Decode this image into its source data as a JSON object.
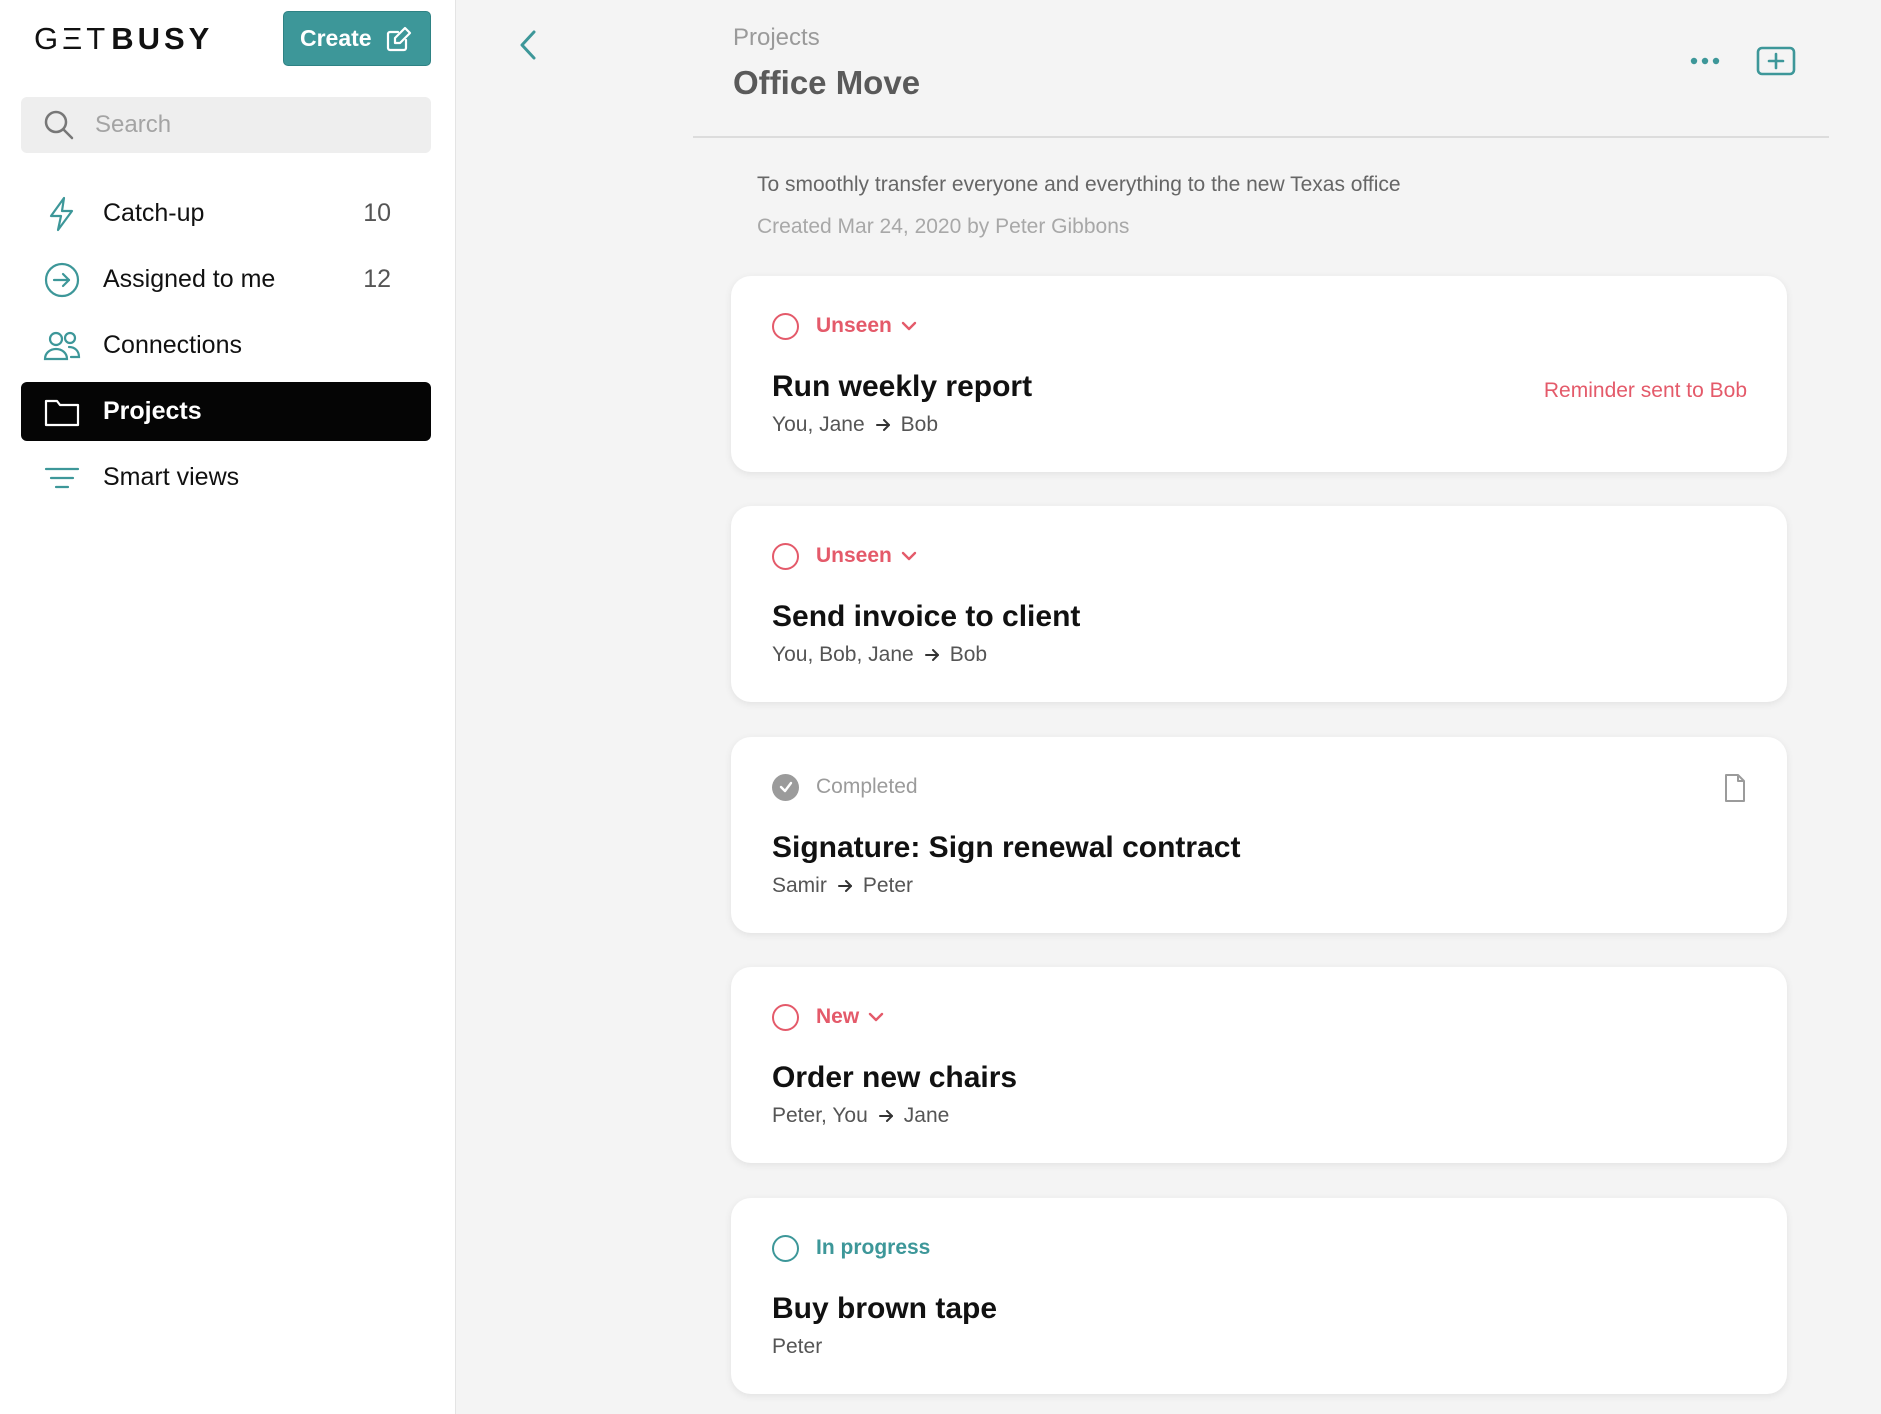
{
  "app": {
    "logo_light": "GΞT",
    "logo_bold": "BUSY",
    "create_label": "Create"
  },
  "search": {
    "placeholder": "Search"
  },
  "sidebar": {
    "items": [
      {
        "label": "Catch-up",
        "count": "10",
        "icon": "lightning-icon"
      },
      {
        "label": "Assigned to me",
        "count": "12",
        "icon": "arrow-circle-icon"
      },
      {
        "label": "Connections",
        "count": "",
        "icon": "people-icon"
      },
      {
        "label": "Projects",
        "count": "",
        "icon": "folder-icon",
        "active": true
      },
      {
        "label": "Smart views",
        "count": "",
        "icon": "filter-lines-icon"
      }
    ]
  },
  "header": {
    "breadcrumb": "Projects",
    "title": "Office Move"
  },
  "project": {
    "description": "To smoothly transfer everyone and everything to the new Texas office",
    "created": "Created Mar 24, 2020 by Peter Gibbons"
  },
  "colors": {
    "accent": "#3d9799",
    "status_red": "#e45a6a",
    "active_nav": "#050505",
    "completed_grey": "#9b9b9b"
  },
  "tasks": [
    {
      "status": "Unseen",
      "title": "Run weekly report",
      "from": "You, Jane",
      "to": "Bob",
      "reminder": "Reminder sent to Bob"
    },
    {
      "status": "Unseen",
      "title": "Send invoice to client",
      "from": "You, Bob, Jane",
      "to": "Bob"
    },
    {
      "status": "Completed",
      "title": "Signature: Sign renewal contract",
      "from": "Samir",
      "to": "Peter",
      "icon": "document-icon"
    },
    {
      "status": "New",
      "title": "Order new chairs",
      "from": "Peter, You",
      "to": "Jane"
    },
    {
      "status": "In progress",
      "title": "Buy brown tape",
      "from": "Peter",
      "to": ""
    }
  ]
}
